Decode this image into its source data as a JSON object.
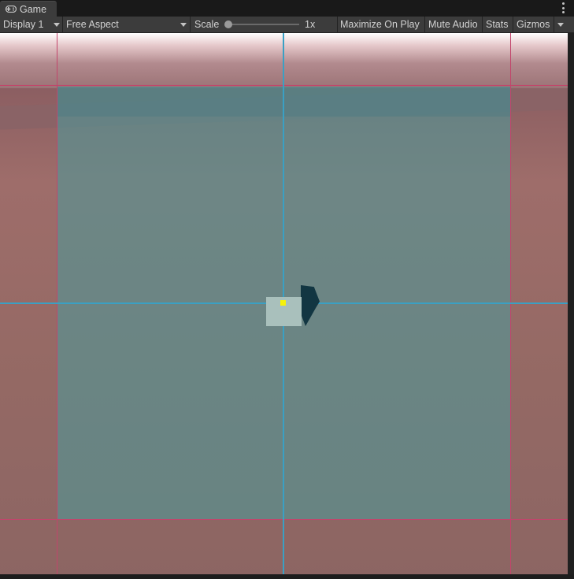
{
  "tab": {
    "title": "Game",
    "icon": "gamepad-icon"
  },
  "window_menu_icon": "kebab-menu-icon",
  "toolbar": {
    "display": "Display 1",
    "aspect": "Free Aspect",
    "scale_label": "Scale",
    "scale_value": "1x",
    "scale_level": 0.0,
    "maximize_on_play": "Maximize On Play",
    "mute_audio": "Mute Audio",
    "stats": "Stats",
    "gizmos": "Gizmos"
  },
  "colors": {
    "background_ground": "#8d6563",
    "canvas_panel": "#5f8f8e",
    "guide_lines": "#c2456b",
    "axis_lines": "#3aa0c4",
    "object": "#a9c0bc",
    "pivot": "#f6f20a"
  }
}
